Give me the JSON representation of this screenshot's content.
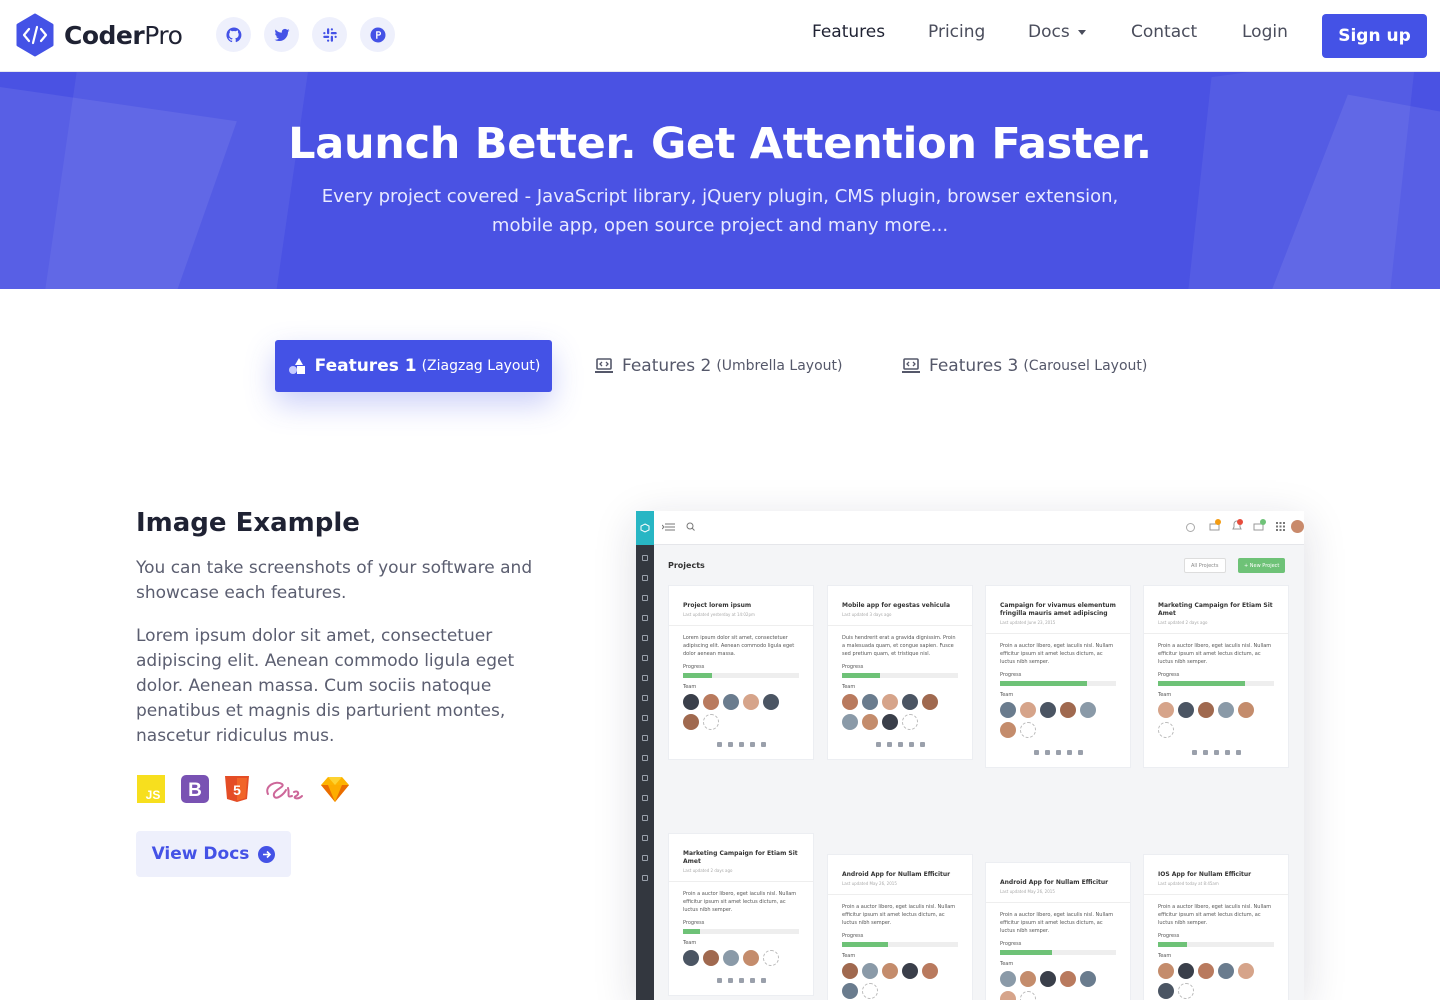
{
  "brand": {
    "name_bold": "Coder",
    "name_light": "Pro",
    "accent": "#4452e6",
    "hero_bg": "#4a52e3"
  },
  "socials": [
    {
      "icon": "github-icon"
    },
    {
      "icon": "twitter-icon"
    },
    {
      "icon": "slack-icon"
    },
    {
      "icon": "producthunt-icon"
    }
  ],
  "nav": {
    "features": "Features",
    "pricing": "Pricing",
    "docs": "Docs",
    "contact": "Contact",
    "login": "Login",
    "signup": "Sign up"
  },
  "hero": {
    "title": "Launch Better. Get Attention Faster.",
    "subtitle": "Every project covered - JavaScript library, jQuery plugin, CMS plugin, browser extension, mobile app, open source project and many more..."
  },
  "tabs": [
    {
      "main": "Features 1",
      "sub": "(Ziagzag Layout)"
    },
    {
      "main": "Features 2",
      "sub": "(Umbrella Layout)"
    },
    {
      "main": "Features 3",
      "sub": "(Carousel Layout)"
    }
  ],
  "feature": {
    "title": "Image Example",
    "p1": "You can take screenshots of your software and showcase each features.",
    "p2": "Lorem ipsum dolor sit amet, consectetuer adipiscing elit. Aenean commodo ligula eget dolor. Aenean massa. Cum sociis natoque penatibus et magnis dis parturient montes, nascetur ridiculus mus.",
    "tech_icons": [
      "js-icon",
      "bootstrap-icon",
      "html5-icon",
      "sass-icon",
      "sketch-icon"
    ],
    "cta": "View Docs"
  },
  "mock": {
    "page_title": "Projects",
    "filter": "All Projects",
    "new_project": "+ New Project",
    "progress_label": "Progress",
    "team_label": "Team",
    "cards": [
      {
        "title": "Project lorem ipsum",
        "updated": "Last updated yesterday at 14:02pm",
        "desc": "Lorem ipsum dolor sit amet, consectetuer adipiscing elit. Aenean commodo ligula eget dolor aenean massa.",
        "progress": 0.25
      },
      {
        "title": "Mobile app for egestas vehicula",
        "updated": "Last updated 3 days ago",
        "desc": "Duis hendrerit erat a gravida dignissim. Proin a malesuada quam, et congue sapien. Fusce sed pretium quam, et tristique nisl.",
        "progress": 0.33
      },
      {
        "title": "Campaign for vivamus elementum fringilla mauris amet adipiscing",
        "updated": "Last updated June 23, 2015",
        "desc": "Proin a auctor libero, eget iaculis nisl. Nullam efficitur ipsum sit amet lectus dictum, ac luctus nibh semper.",
        "progress": 0.75
      },
      {
        "title": "Marketing Campaign for Etiam Sit Amet",
        "updated": "Last updated 2 days ago",
        "desc": "Proin a auctor libero, eget iaculis nisl. Nullam efficitur ipsum sit amet lectus dictum, ac luctus nibh semper.",
        "progress": 0.75
      },
      {
        "title": "Marketing Campaign for Etiam Sit Amet",
        "updated": "Last updated 2 days ago",
        "desc": "Proin a auctor libero, eget iaculis nisl. Nullam efficitur ipsum sit amet lectus dictum, ac luctus nibh semper.",
        "progress": 0.15
      },
      {
        "title": "Android App for Nullam Efficitur",
        "updated": "Last updated May 26, 2015",
        "desc": "Proin a auctor libero, eget iaculis nisl. Nullam efficitur ipsum sit amet lectus dictum, ac luctus nibh semper.",
        "progress": 0.4
      },
      {
        "title": "Android App for Nullam Efficitur",
        "updated": "Last updated May 26, 2015",
        "desc": "Proin a auctor libero, eget iaculis nisl. Nullam efficitur ipsum sit amet lectus dictum, ac luctus nibh semper.",
        "progress": 0.45
      },
      {
        "title": "IOS App for Nullam Efficitur",
        "updated": "Last updated today at 8:45am",
        "desc": "Proin a auctor libero, eget iaculis nisl. Nullam efficitur ipsum sit amet lectus dictum, ac luctus nibh semper.",
        "progress": 0.25
      }
    ]
  }
}
